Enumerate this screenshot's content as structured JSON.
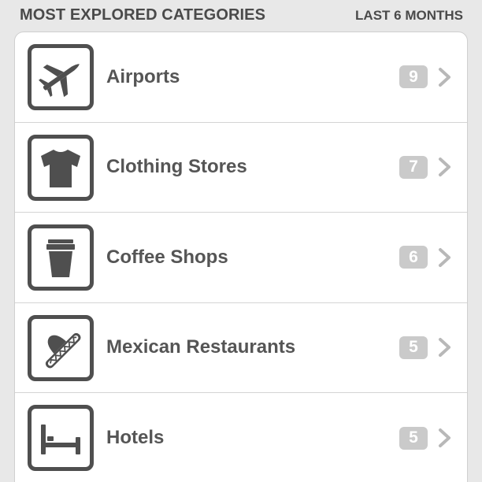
{
  "header": {
    "title": "MOST EXPLORED CATEGORIES",
    "range": "LAST 6 MONTHS"
  },
  "colors": {
    "background": "#e8e8e8",
    "card": "#ffffff",
    "icon": "#4f4f4f",
    "label": "#555555",
    "badge": "#cacaca",
    "chevron": "#b8b8b8"
  },
  "categories": [
    {
      "label": "Airports",
      "count": "9",
      "icon": "airplane-icon"
    },
    {
      "label": "Clothing Stores",
      "count": "7",
      "icon": "tshirt-icon"
    },
    {
      "label": "Coffee Shops",
      "count": "6",
      "icon": "coffee-cup-icon"
    },
    {
      "label": "Mexican Restaurants",
      "count": "5",
      "icon": "sombrero-icon"
    },
    {
      "label": "Hotels",
      "count": "5",
      "icon": "bed-icon"
    }
  ]
}
